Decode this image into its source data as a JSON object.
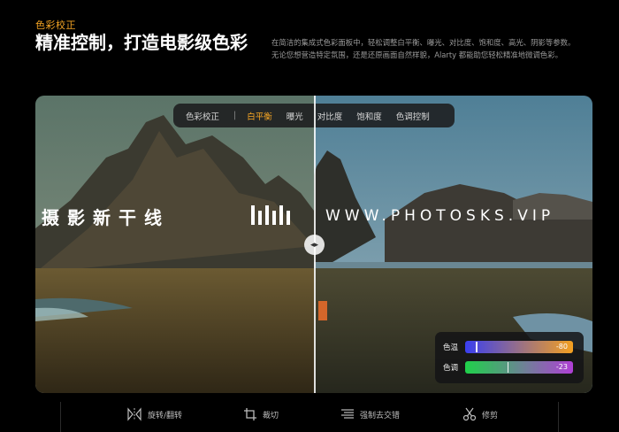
{
  "header": {
    "eyebrow": "色彩校正",
    "headline": "精准控制，打造电影级色彩",
    "description_line1": "在简洁的集成式色彩面板中，轻松调整白平衡、曝光、对比度、饱和度、高光、阴影等参数。",
    "description_line2": "无论您想营造特定氛围，还是还原画面自然样貌，Alarty 都能助您轻松精准地微调色彩。"
  },
  "tabs": {
    "section": "色彩校正",
    "separator": "|",
    "items": [
      "白平衡",
      "曝光",
      "对比度",
      "饱和度",
      "色调控制"
    ],
    "active_index": 0
  },
  "watermark": {
    "cn_text": "摄影新干线",
    "url": "WWW.PHOTOSKS.VIP"
  },
  "handle": {
    "icon": "split-arrows-icon"
  },
  "adjustments": [
    {
      "label": "色温",
      "value": "-80",
      "level": 0.1,
      "gradient": [
        "#3a3ff0",
        "#f4a020"
      ]
    },
    {
      "label": "色调",
      "value": "-23",
      "level": 0.39,
      "gradient": [
        "#1fd14a",
        "#b03fd6"
      ]
    }
  ],
  "toolbar": {
    "items": [
      {
        "label": "旋转/翻转",
        "icon": "flip-icon"
      },
      {
        "label": "裁切",
        "icon": "crop-icon"
      },
      {
        "label": "强制去交错",
        "icon": "deinterlace-icon"
      },
      {
        "label": "修剪",
        "icon": "scissors-icon"
      }
    ]
  },
  "colors": {
    "accent": "#f5a524",
    "background": "#000000",
    "panel": "#1c1c1e"
  }
}
